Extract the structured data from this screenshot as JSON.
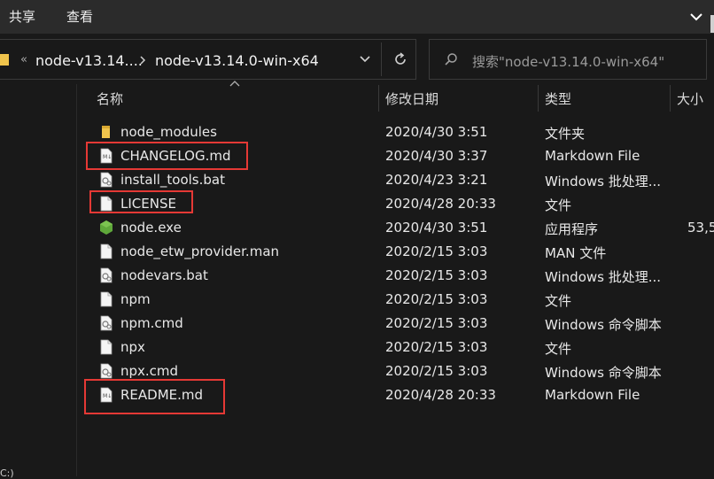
{
  "ribbon": {
    "share": "共享",
    "view": "查看"
  },
  "address": {
    "crumbs": [
      "node-v13.14....",
      "node-v13.14.0-win-x64"
    ],
    "crumb_sep": "«"
  },
  "search": {
    "placeholder": "搜索\"node-v13.14.0-win-x64\""
  },
  "columns": {
    "name": "名称",
    "date": "修改日期",
    "type": "类型",
    "size": "大小"
  },
  "files": [
    {
      "name": "node_modules",
      "date": "2020/4/30 3:51",
      "type": "文件夹",
      "size": "",
      "icon": "folder-icon"
    },
    {
      "name": "CHANGELOG.md",
      "date": "2020/4/30 3:37",
      "type": "Markdown File",
      "size": "",
      "icon": "markdown-file-icon"
    },
    {
      "name": "install_tools.bat",
      "date": "2020/4/23 3:21",
      "type": "Windows 批处理...",
      "size": "",
      "icon": "batch-file-icon"
    },
    {
      "name": "LICENSE",
      "date": "2020/4/28 20:33",
      "type": "文件",
      "size": "",
      "icon": "file-icon"
    },
    {
      "name": "node.exe",
      "date": "2020/4/30 3:51",
      "type": "应用程序",
      "size": "53,5",
      "icon": "nodejs-icon"
    },
    {
      "name": "node_etw_provider.man",
      "date": "2020/2/15 3:03",
      "type": "MAN 文件",
      "size": "",
      "icon": "file-icon"
    },
    {
      "name": "nodevars.bat",
      "date": "2020/2/15 3:03",
      "type": "Windows 批处理...",
      "size": "",
      "icon": "batch-file-icon"
    },
    {
      "name": "npm",
      "date": "2020/2/15 3:03",
      "type": "文件",
      "size": "",
      "icon": "file-icon"
    },
    {
      "name": "npm.cmd",
      "date": "2020/2/15 3:03",
      "type": "Windows 命令脚本",
      "size": "",
      "icon": "batch-file-icon"
    },
    {
      "name": "npx",
      "date": "2020/2/15 3:03",
      "type": "文件",
      "size": "",
      "icon": "file-icon"
    },
    {
      "name": "npx.cmd",
      "date": "2020/2/15 3:03",
      "type": "Windows 命令脚本",
      "size": "",
      "icon": "batch-file-icon"
    },
    {
      "name": "README.md",
      "date": "2020/4/28 20:33",
      "type": "Markdown File",
      "size": "",
      "icon": "markdown-file-icon"
    }
  ],
  "nav_fragment": "C:)",
  "colors": {
    "background": "#191919",
    "ribbon": "#2b2b2b",
    "highlight": "#e53935",
    "folder": "#f0c44c",
    "nodejs": "#5fa83a"
  }
}
